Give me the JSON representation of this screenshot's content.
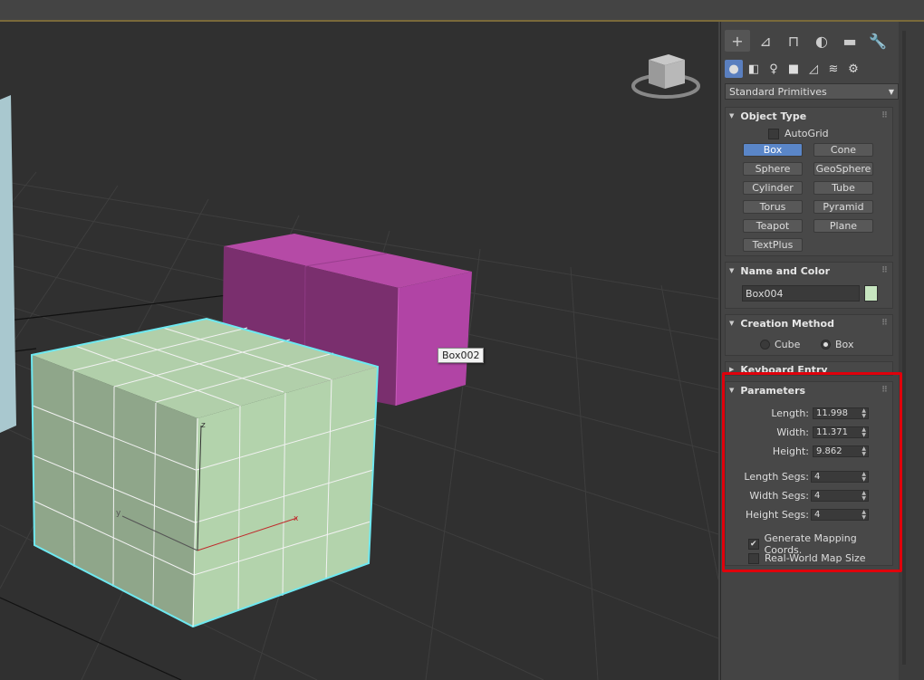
{
  "viewport": {
    "object_tooltip": "Box002",
    "selected_box_axes": {
      "x": "x",
      "y": "y",
      "z": "z"
    }
  },
  "command_panel": {
    "tabs": [
      {
        "icon": "create-plus-icon",
        "glyph": "+"
      },
      {
        "icon": "modify-icon",
        "glyph": "⊿"
      },
      {
        "icon": "hierarchy-icon",
        "glyph": "⊓"
      },
      {
        "icon": "motion-icon",
        "glyph": "◐"
      },
      {
        "icon": "display-icon",
        "glyph": "▬"
      },
      {
        "icon": "utilities-wrench-icon",
        "glyph": "🔧"
      }
    ],
    "subtabs": [
      {
        "icon": "geometry-icon",
        "glyph": "●"
      },
      {
        "icon": "shapes-icon",
        "glyph": "◧"
      },
      {
        "icon": "lights-icon",
        "glyph": "♀"
      },
      {
        "icon": "cameras-icon",
        "glyph": "■"
      },
      {
        "icon": "helpers-icon",
        "glyph": "◿"
      },
      {
        "icon": "space-warps-icon",
        "glyph": "≋"
      },
      {
        "icon": "systems-icon",
        "glyph": "⚙"
      }
    ],
    "category_dropdown": "Standard Primitives",
    "object_type": {
      "title": "Object Type",
      "autogrid_label": "AutoGrid",
      "buttons": [
        "Box",
        "Cone",
        "Sphere",
        "GeoSphere",
        "Cylinder",
        "Tube",
        "Torus",
        "Pyramid",
        "Teapot",
        "Plane",
        "TextPlus"
      ],
      "active_button": "Box"
    },
    "name_and_color": {
      "title": "Name and Color",
      "name_value": "Box004",
      "color": "#c7e6c0"
    },
    "creation_method": {
      "title": "Creation Method",
      "options": [
        "Cube",
        "Box"
      ],
      "selected": "Box"
    },
    "keyboard_entry": {
      "title": "Keyboard Entry"
    },
    "parameters": {
      "title": "Parameters",
      "length_label": "Length:",
      "length": "11.998",
      "width_label": "Width:",
      "width": "11.371",
      "height_label": "Height:",
      "height": "9.862",
      "length_segs_label": "Length Segs:",
      "length_segs": "4",
      "width_segs_label": "Width Segs:",
      "width_segs": "4",
      "height_segs_label": "Height Segs:",
      "height_segs": "4",
      "gen_mapping_label": "Generate Mapping Coords.",
      "gen_mapping_checked": true,
      "real_world_label": "Real-World Map Size",
      "real_world_checked": false
    }
  },
  "colors": {
    "highlight": "#e0000b",
    "selection_outline": "#6ee8f0",
    "magenta_box": "#b546a8",
    "green_box": "#b5d2ad",
    "active_button": "#5a86c8"
  }
}
